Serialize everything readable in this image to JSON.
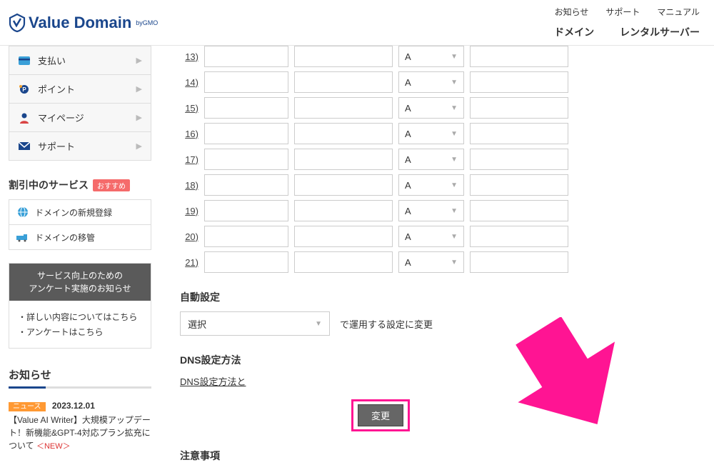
{
  "header": {
    "logo_main": "Value Domain",
    "logo_sub": "byGMO",
    "top_links": [
      "お知らせ",
      "サポート",
      "マニュアル"
    ],
    "bottom_links": [
      "ドメイン",
      "レンタルサーバー"
    ]
  },
  "sidebar_menu": [
    {
      "icon": "card-icon",
      "label": "支払い"
    },
    {
      "icon": "point-icon",
      "label": "ポイント"
    },
    {
      "icon": "mypage-icon",
      "label": "マイページ"
    },
    {
      "icon": "support-icon",
      "label": "サポート"
    }
  ],
  "promo": {
    "title": "割引中のサービス",
    "badge": "おすすめ",
    "items": [
      {
        "icon": "globe-icon",
        "label": "ドメインの新規登録"
      },
      {
        "icon": "transfer-icon",
        "label": "ドメインの移管"
      }
    ]
  },
  "survey": {
    "header_line1": "サービス向上のための",
    "header_line2": "アンケート実施のお知らせ",
    "links": [
      "・詳しい内容についてはこちら",
      "・アンケートはこちら"
    ]
  },
  "news": {
    "title": "お知らせ",
    "tag": "ニュース",
    "date": "2023.12.01",
    "body": "【Value AI Writer】大規模アップデート！新機能&GPT-4対応プラン拡充について",
    "new_label": "＜NEW＞"
  },
  "dns": {
    "rows": [
      {
        "num": "13)",
        "type": "A"
      },
      {
        "num": "14)",
        "type": "A"
      },
      {
        "num": "15)",
        "type": "A"
      },
      {
        "num": "16)",
        "type": "A"
      },
      {
        "num": "17)",
        "type": "A"
      },
      {
        "num": "18)",
        "type": "A"
      },
      {
        "num": "19)",
        "type": "A"
      },
      {
        "num": "20)",
        "type": "A"
      },
      {
        "num": "21)",
        "type": "A"
      }
    ],
    "auto_title": "自動設定",
    "auto_select_placeholder": "選択",
    "auto_suffix": "で運用する設定に変更",
    "method_title": "DNS設定方法",
    "method_link": "DNS設定方法と",
    "submit_label": "変更",
    "notes_title": "注意事項"
  }
}
